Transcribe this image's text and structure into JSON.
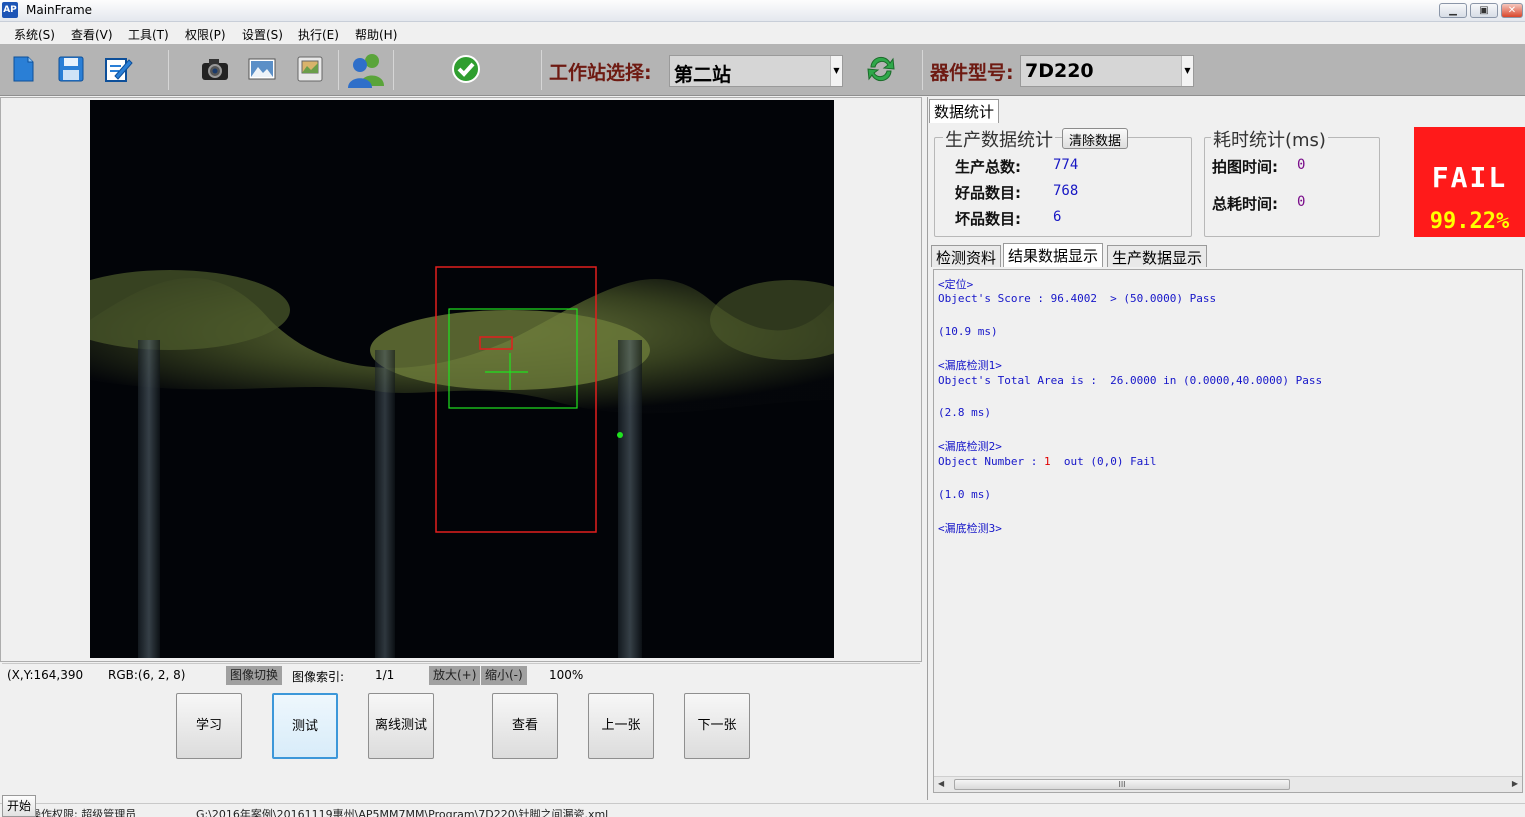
{
  "window": {
    "icon_text": "AP",
    "title": "MainFrame",
    "minimize": "▁",
    "maximize": "▣",
    "close": "✕"
  },
  "menu": [
    "系统(S)",
    "查看(V)",
    "工具(T)",
    "权限(P)",
    "设置(S)",
    "执行(E)",
    "帮助(H)"
  ],
  "toolbar": {
    "station_label": "工作站选择:",
    "station_value": "第二站",
    "device_label": "器件型号:",
    "device_value": "7D220",
    "icons": [
      "new-file-icon",
      "save-icon",
      "edit-icon",
      "camera-icon",
      "image-icon",
      "image-save-icon",
      "users-icon",
      "check-icon",
      "refresh-icon"
    ]
  },
  "image_status": {
    "coords": "(X,Y:164,390",
    "rgb": "RGB:(6, 2, 8)",
    "switch_btn": "图像切换",
    "index_label": "图像索引:",
    "index_value": "1/1",
    "zoom_in": "放大(+)",
    "zoom_out": "缩小(-)",
    "zoom": "100%"
  },
  "actions": [
    "学习",
    "测试",
    "离线测试",
    "查看",
    "上一张",
    "下一张"
  ],
  "right": {
    "top_tab": "数据统计",
    "prod_group": "生产数据统计",
    "clear_btn": "清除数据",
    "total_label": "生产总数:",
    "total_value": "774",
    "good_label": "好品数目:",
    "good_value": "768",
    "bad_label": "坏品数目:",
    "bad_value": "6",
    "time_group": "耗时统计(ms)",
    "capture_label": "拍图时间:",
    "capture_value": "0",
    "total_time_label": "总耗时间:",
    "total_time_value": "0",
    "result": "FAIL",
    "yield": "99.22%",
    "tabs": [
      "检测资料",
      "结果数据显示",
      "生产数据显示"
    ],
    "log": [
      "<定位>",
      "Object's Score : 96.4002  > (50.0000) Pass",
      "",
      "(10.9 ms)",
      "",
      "<漏底检测1>",
      "Object's Total Area is :  26.0000 in (0.0000,40.0000) Pass",
      "",
      "(2.8 ms)",
      "",
      "<漏底检测2>",
      "",
      "",
      "(1.0 ms)",
      "",
      "<漏底检测3>"
    ],
    "log_obj_prefix": "Object Number : ",
    "log_obj_value": "1",
    "log_obj_suffix": "  out (0,0) Fail",
    "scroll_grip": "III"
  },
  "statusbar": {
    "start": "开始",
    "permission": "操作权限: 超级管理员",
    "path": "G:\\2016年案例\\20161119惠州\\AP5MM7MM\\Program\\7D220\\针脚之间漏瓷.xml"
  },
  "colors": {
    "fail_bg": "#ff1a1a",
    "yield_fg": "#ffff00",
    "log_text": "#1616c9",
    "toolbar_label": "#6e1a12"
  }
}
